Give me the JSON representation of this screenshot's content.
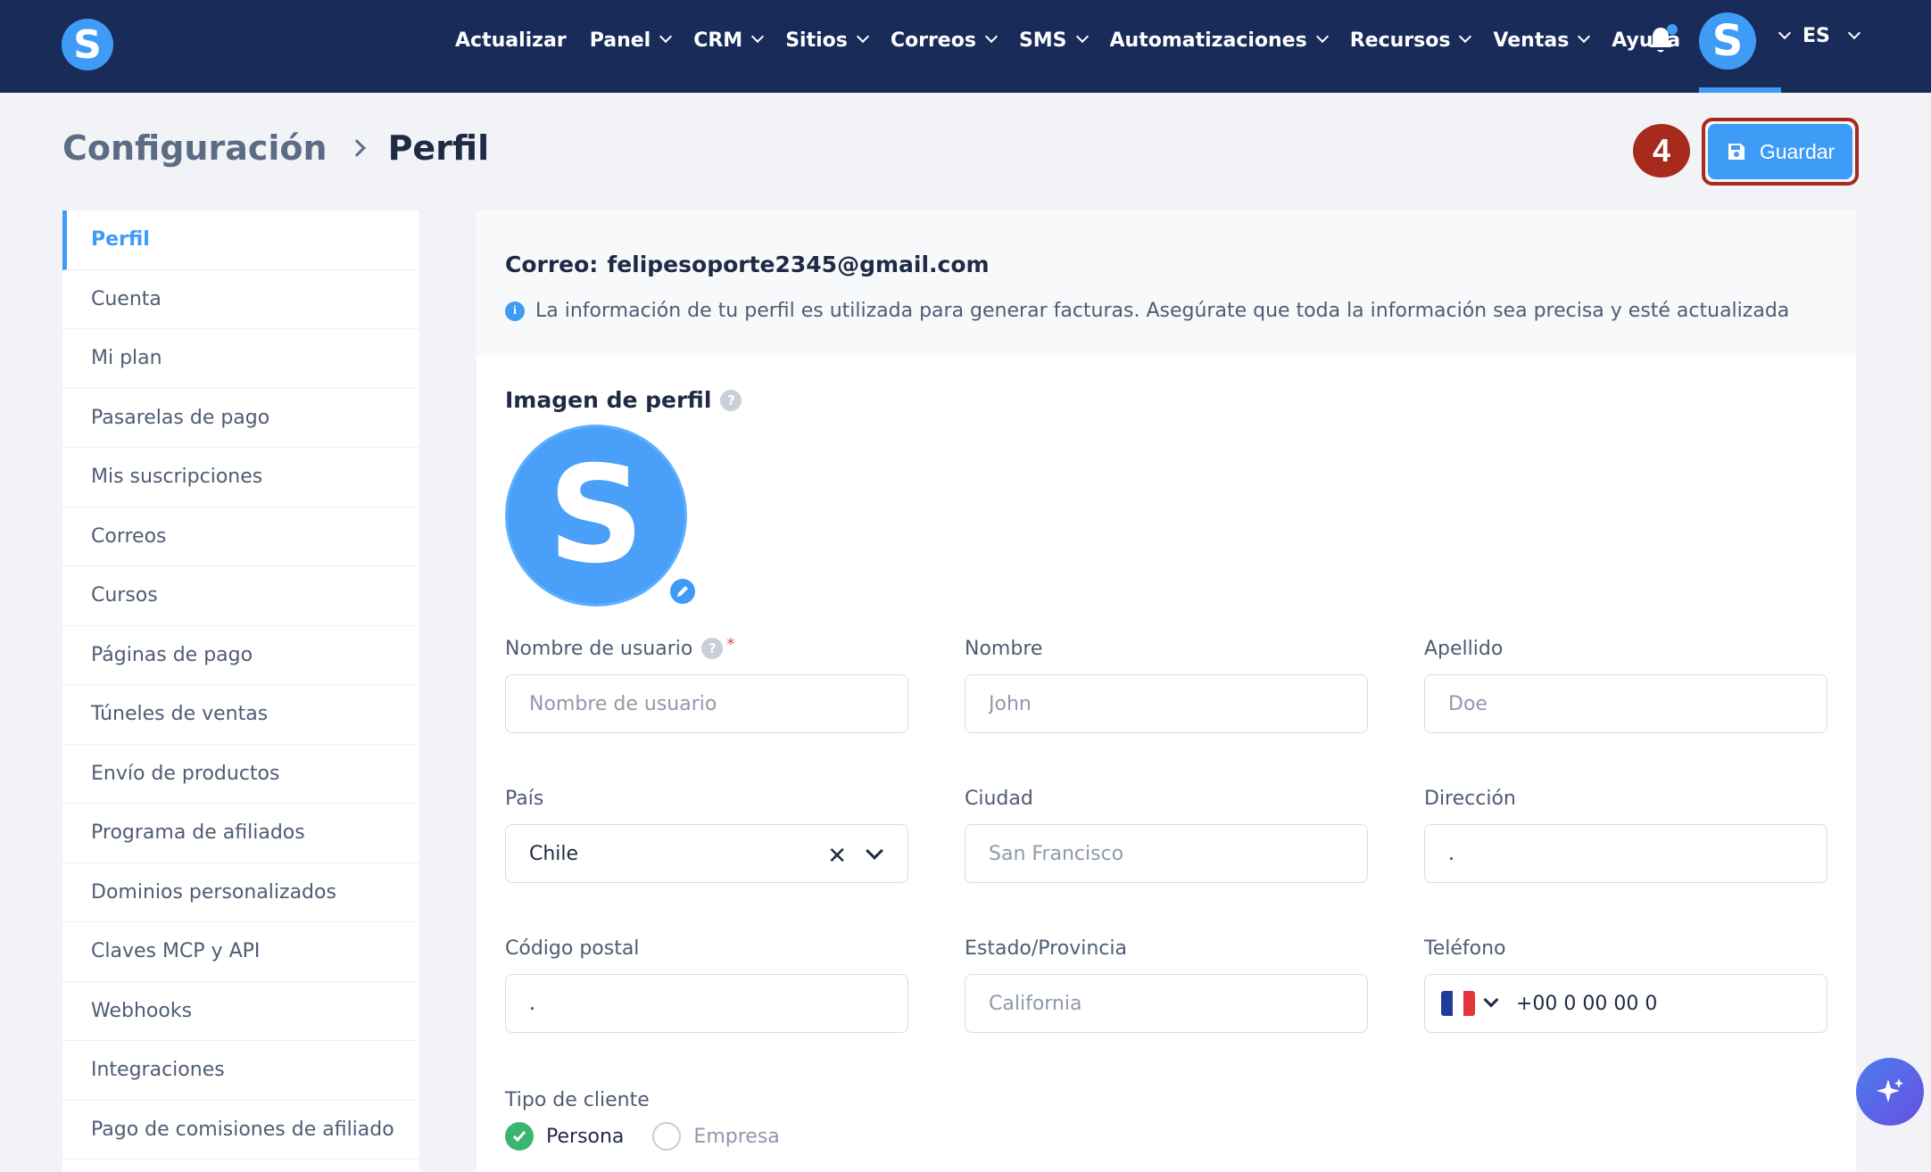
{
  "app": {
    "logo_letter": "S"
  },
  "nav": {
    "items": [
      {
        "label": "Actualizar",
        "dropdown": false
      },
      {
        "label": "Panel",
        "dropdown": true
      },
      {
        "label": "CRM",
        "dropdown": true
      },
      {
        "label": "Sitios",
        "dropdown": true
      },
      {
        "label": "Correos",
        "dropdown": true
      },
      {
        "label": "SMS",
        "dropdown": true
      },
      {
        "label": "Automatizaciones",
        "dropdown": true
      },
      {
        "label": "Recursos",
        "dropdown": true
      },
      {
        "label": "Ventas",
        "dropdown": true
      },
      {
        "label": "Ayuda",
        "dropdown": false
      }
    ],
    "avatar_letter": "S",
    "language": "ES"
  },
  "header": {
    "breadcrumb_parent": "Configuración",
    "breadcrumb_current": "Perfil",
    "step_number": "4",
    "save_label": "Guardar"
  },
  "sidebar": {
    "items": [
      {
        "label": "Perfil",
        "active": true
      },
      {
        "label": "Cuenta"
      },
      {
        "label": "Mi plan"
      },
      {
        "label": "Pasarelas de pago"
      },
      {
        "label": "Mis suscripciones"
      },
      {
        "label": "Correos"
      },
      {
        "label": "Cursos"
      },
      {
        "label": "Páginas de pago"
      },
      {
        "label": "Túneles de ventas"
      },
      {
        "label": "Envío de productos"
      },
      {
        "label": "Programa de afiliados"
      },
      {
        "label": "Dominios personalizados"
      },
      {
        "label": "Claves MCP y API"
      },
      {
        "label": "Webhooks"
      },
      {
        "label": "Integraciones"
      },
      {
        "label": "Pago de comisiones de afiliado"
      }
    ]
  },
  "profile": {
    "email_label": "Correo:",
    "email_value": "felipesoporte2345@gmail.com",
    "info_text": "La información de tu perfil es utilizada para generar facturas. Asegúrate que toda la información sea precisa y esté actualizada",
    "image_title": "Imagen de perfil",
    "image_letter": "S",
    "fields": {
      "username": {
        "label": "Nombre de usuario",
        "value": "",
        "placeholder": "Nombre de usuario",
        "required_mark": "*"
      },
      "first_name": {
        "label": "Nombre",
        "value": "",
        "placeholder": "John"
      },
      "last_name": {
        "label": "Apellido",
        "value": "",
        "placeholder": "Doe"
      },
      "country": {
        "label": "País",
        "value": "Chile"
      },
      "city": {
        "label": "Ciudad",
        "value": "",
        "placeholder": "San Francisco"
      },
      "address": {
        "label": "Dirección",
        "value": ".",
        "placeholder": ""
      },
      "postal_code": {
        "label": "Código postal",
        "value": ".",
        "placeholder": ""
      },
      "state": {
        "label": "Estado/Provincia",
        "value": "",
        "placeholder": "California"
      },
      "phone": {
        "label": "Teléfono",
        "value": "+00 0 00 00 0"
      }
    },
    "customer_type": {
      "label": "Tipo de cliente",
      "options": [
        {
          "label": "Persona",
          "selected": true
        },
        {
          "label": "Empresa",
          "selected": false
        }
      ]
    }
  },
  "colors": {
    "nav_bg": "#192b59",
    "accent": "#3e9cf7",
    "highlight": "#a82a1d",
    "success": "#3cb572"
  }
}
